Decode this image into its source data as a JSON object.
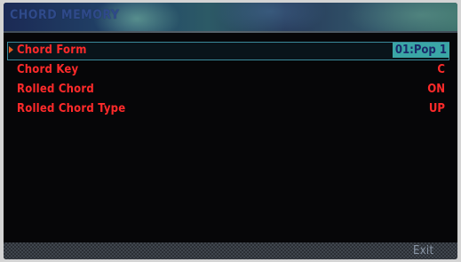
{
  "header": {
    "title": "CHORD MEMORY"
  },
  "rows": [
    {
      "label": "Chord Form",
      "value": "01:Pop 1",
      "selected": true
    },
    {
      "label": "Chord Key",
      "value": "C",
      "selected": false
    },
    {
      "label": "Rolled Chord",
      "value": "ON",
      "selected": false
    },
    {
      "label": "Rolled Chord Type",
      "value": "UP",
      "selected": false
    }
  ],
  "footer": {
    "exit_label": "Exit"
  },
  "colors": {
    "text_red": "#ff2a2a",
    "highlight_teal": "#3aa6a6",
    "highlight_text": "#1a2a6a",
    "cursor_orange": "#e05a20",
    "background": "#060608"
  },
  "icons": {
    "cursor": "cursor-triangle-icon"
  }
}
